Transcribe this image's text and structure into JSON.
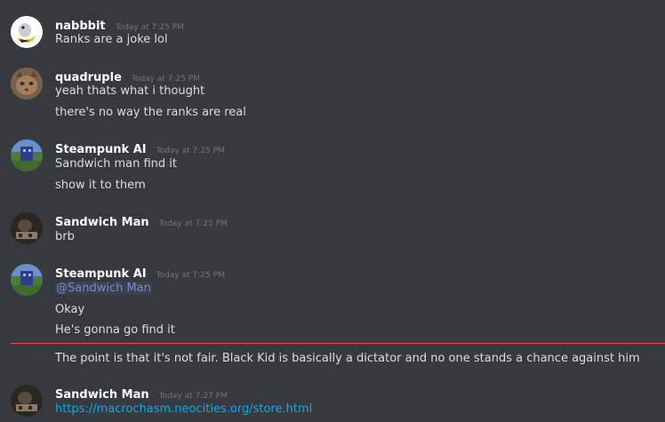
{
  "messages": [
    {
      "username": "nabbbit",
      "timestamp": "Today at 7:25 PM",
      "lines": [
        "Ranks are a joke lol"
      ]
    },
    {
      "username": "quadruple",
      "timestamp": "Today at 7:25 PM",
      "lines": [
        "yeah thats what i thought",
        "there's no way the ranks are real"
      ]
    },
    {
      "username": "Steampunk AI",
      "timestamp": "Today at 7:25 PM",
      "lines": [
        "Sandwich man find it",
        "show it to them"
      ]
    },
    {
      "username": "Sandwich Man",
      "timestamp": "Today at 7:25 PM",
      "lines": [
        "brb"
      ]
    },
    {
      "username": "Steampunk AI",
      "timestamp": "Today at 7:25 PM",
      "mention": "@Sandwich Man",
      "lines": [
        "Okay",
        "He's gonna go find it",
        "The point is that it's not fair. Black Kid is basically a dictator and no one stands a chance against him"
      ]
    },
    {
      "username": "Sandwich Man",
      "timestamp": "Today at 7:27 PM",
      "link": "https://macrochasm.neocities.org/store.html"
    }
  ],
  "colors": {
    "background": "#36393f",
    "username": "#ffffff",
    "timestamp": "#72767d",
    "text": "#dcddde",
    "mention": "#7289da",
    "link": "#00b0f4",
    "new_divider": "#f04747"
  }
}
